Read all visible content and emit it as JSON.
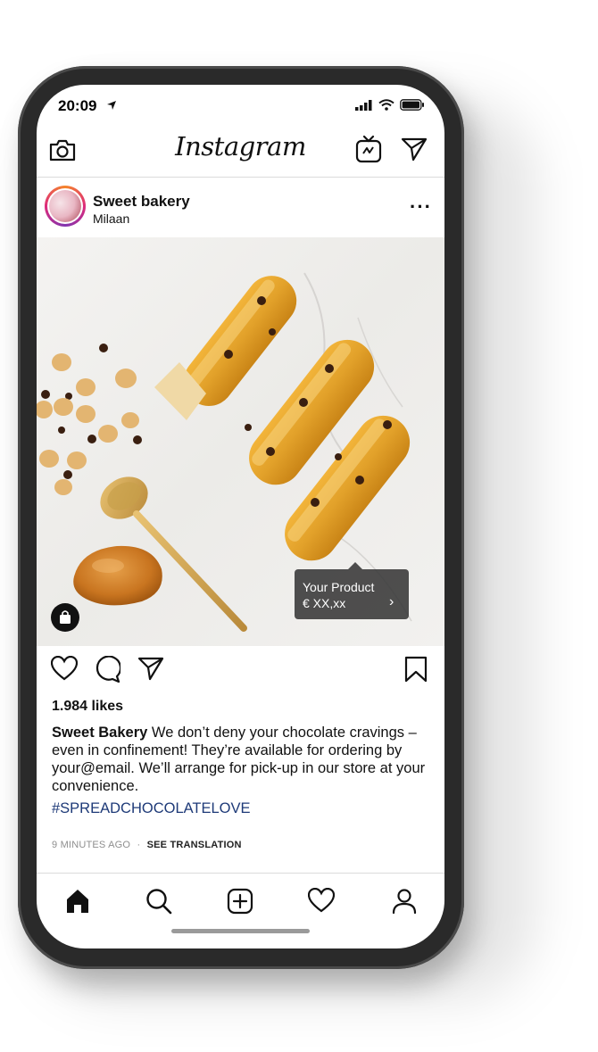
{
  "status_bar": {
    "time": "20:09"
  },
  "header": {
    "logo": "Instagram"
  },
  "post": {
    "username": "Sweet bakery",
    "location": "Milaan",
    "product_tag": {
      "title": "Your Product",
      "price": "€ XX,xx"
    },
    "likes": "1.984 likes",
    "caption_author": "Sweet Bakery",
    "caption_text": " We don’t deny your chocolate cravings – even in confinement! They’re available for ordering by your@email. We’ll arrange for pick-up in our store at your convenience.",
    "hashtag": "#SPREADCHOCOLATELOVE",
    "timestamp": "9 MINUTES AGO",
    "separator": "·",
    "translate": "SEE TRANSLATION"
  },
  "bottom_nav": {
    "items": [
      "home",
      "search",
      "add",
      "activity",
      "profile"
    ]
  },
  "colors": {
    "hashtag": "#1e3a78",
    "divider": "#dbdbdb",
    "tag_bg": "#373737"
  }
}
